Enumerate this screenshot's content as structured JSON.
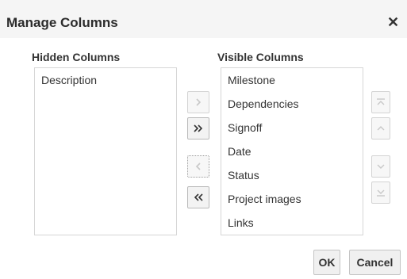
{
  "dialog": {
    "title": "Manage Columns",
    "close_glyph": "✕"
  },
  "hidden": {
    "label": "Hidden Columns",
    "items": [
      "Description"
    ]
  },
  "visible": {
    "label": "Visible Columns",
    "items": [
      "Milestone",
      "Dependencies",
      "Signoff",
      "Date",
      "Status",
      "Project images",
      "Links"
    ]
  },
  "move_buttons": [
    {
      "name": "move-right-icon",
      "enabled": false
    },
    {
      "name": "move-all-right-icon",
      "enabled": true
    },
    {
      "name": "move-left-icon",
      "enabled": false
    },
    {
      "name": "move-all-left-icon",
      "enabled": true
    }
  ],
  "order_buttons": [
    {
      "name": "move-top-icon",
      "enabled": false
    },
    {
      "name": "move-up-icon",
      "enabled": false
    },
    {
      "name": "move-down-icon",
      "enabled": false
    },
    {
      "name": "move-bottom-icon",
      "enabled": false
    }
  ],
  "footer": {
    "ok_label": "OK",
    "cancel_label": "Cancel"
  },
  "colors": {
    "header_bg": "#f5f5f5",
    "border": "#d6d6d6",
    "disabled_icon": "#c8c8c8",
    "enabled_icon": "#333333"
  }
}
